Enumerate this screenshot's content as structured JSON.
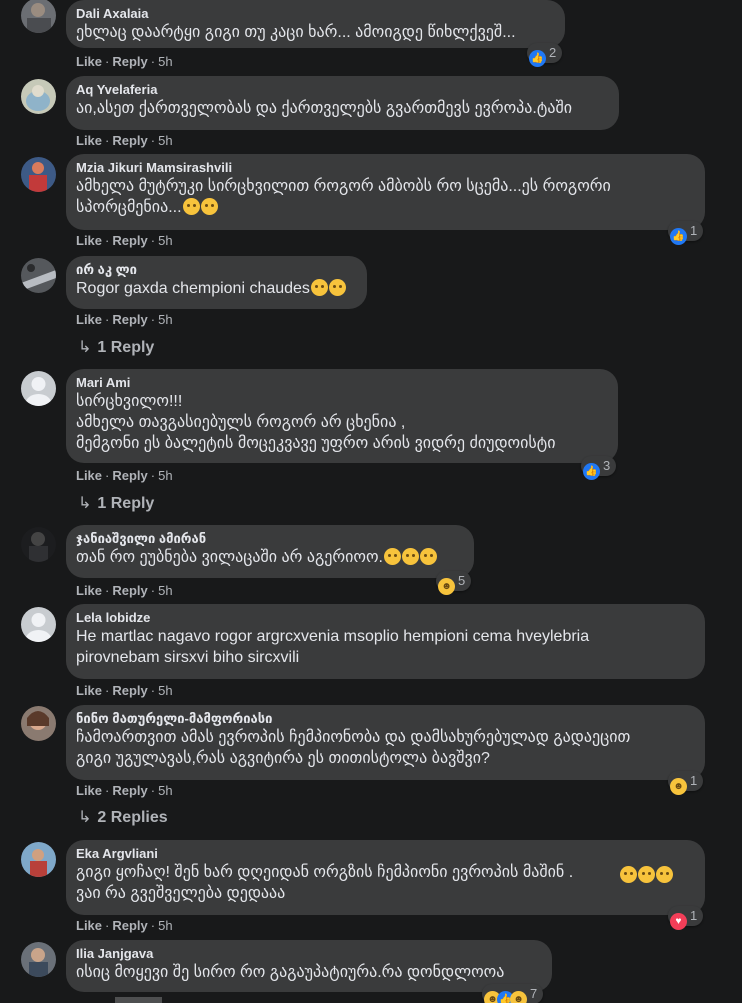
{
  "colors": {
    "background": "#18191a",
    "bubble": "#3a3b3c",
    "text": "#e4e6eb",
    "secondary_text": "#b0b3b8",
    "like_blue": "#2078f4",
    "love_red": "#f33e58",
    "haha_yellow": "#f7c33c"
  },
  "actions": {
    "like": "Like",
    "reply": "Reply",
    "separator": "·"
  },
  "comments": [
    {
      "author": "Dali Axalaia",
      "text": "ეხლაც დაარტყი გიგი თუ კაცი ხარ... ამოიგდე წიხლქვეშ...",
      "emojis": [],
      "time": "5h",
      "reactions": {
        "icons": [
          "like-icon"
        ],
        "count": "2"
      },
      "replies": ""
    },
    {
      "author": "Aq Yvelaferia",
      "text": "აი,ასეთ ქართველობას და ქართველებს გვართმევს ევროპა.ტაში",
      "emojis": [],
      "time": "5h",
      "reactions": null,
      "replies": ""
    },
    {
      "author": "Mzia Jikuri Mamsirashvili",
      "text": "ამხელა მუტრუკი სირცხვილით როგორ ამბობს რო სცემა...ეს როგორი\nსპორცმენია...",
      "emojis": [
        "astonished-emoji",
        "frowning-emoji"
      ],
      "time": "5h",
      "reactions": {
        "icons": [
          "like-icon"
        ],
        "count": "1"
      },
      "replies": ""
    },
    {
      "author": "ირ აკ ლი",
      "text": "Rogor gaxda chempioni chaudes",
      "emojis": [
        "grimacing-emoji",
        "grimacing-emoji"
      ],
      "time": "5h",
      "reactions": null,
      "replies": "1 Reply"
    },
    {
      "author": "Mari Ami",
      "text": "სირცხვილო!!!\nამხელა თავგასიებულს როგორ არ ცხენია ,\nმემგონი ეს ბალეტის მოცეკვავე უფრო არის ვიდრე ძიუდოისტი",
      "emojis": [],
      "time": "5h",
      "reactions": {
        "icons": [
          "like-icon"
        ],
        "count": "3"
      },
      "replies": "1 Reply"
    },
    {
      "author": "ჯანიაშვილი ამირან",
      "text": "თან რო ეუბნება ვილაცაში არ აგერიოო.",
      "emojis": [
        "sweat-smile-emoji",
        "sweat-smile-emoji",
        "sweat-smile-emoji"
      ],
      "time": "5h",
      "reactions": {
        "icons": [
          "haha-icon"
        ],
        "count": "5"
      },
      "replies": ""
    },
    {
      "author": "Lela lobidze",
      "text": "He martlac nagavo rogor argrcxvenia msoplio hempioni cema hveylebria\npirovnebam sirsxvi biho sircxvili",
      "emojis": [],
      "time": "5h",
      "reactions": null,
      "replies": ""
    },
    {
      "author": "ნინო მათურელი-მამფორიასი",
      "text": "ჩამოართვით ამას ევროპის ჩემპიონობა და დამსახურებულად გადაეცით\nგიგი უგულავას,რას აგვიტირა ეს თითისტოლა ბავშვი?",
      "emojis": [],
      "time": "5h",
      "reactions": {
        "icons": [
          "haha-icon"
        ],
        "count": "1"
      },
      "replies": "2 Replies"
    },
    {
      "author": "Eka Argvliani",
      "text": "გიგი ყოჩაღ! შენ ხარ დღეიდან ორგზის ჩემპიონი ევროპის მაშინ .\nვაი რა გვეშველება დედააა",
      "emojis": [
        "grinning-emoji",
        "grinning-emoji",
        "grinning-emoji"
      ],
      "time": "5h",
      "reactions": {
        "icons": [
          "love-icon"
        ],
        "count": "1"
      },
      "replies": ""
    },
    {
      "author": "Ilia Janjgava",
      "text": "ისიც მოყევი შე სირო რო გაგაუპატიურა.რა დონდლოოა",
      "emojis": [],
      "time": "",
      "reactions": {
        "icons": [
          "haha-icon",
          "like-icon",
          "haha-icon"
        ],
        "count": "7"
      },
      "replies": ""
    }
  ]
}
